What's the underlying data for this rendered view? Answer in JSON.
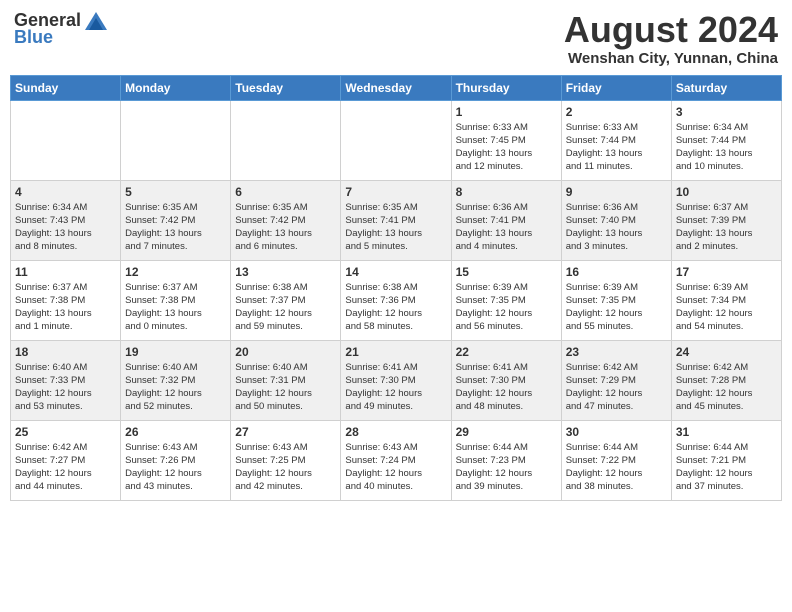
{
  "header": {
    "logo_general": "General",
    "logo_blue": "Blue",
    "month_title": "August 2024",
    "subtitle": "Wenshan City, Yunnan, China"
  },
  "days_of_week": [
    "Sunday",
    "Monday",
    "Tuesday",
    "Wednesday",
    "Thursday",
    "Friday",
    "Saturday"
  ],
  "weeks": [
    [
      {
        "day": "",
        "info": ""
      },
      {
        "day": "",
        "info": ""
      },
      {
        "day": "",
        "info": ""
      },
      {
        "day": "",
        "info": ""
      },
      {
        "day": "1",
        "info": "Sunrise: 6:33 AM\nSunset: 7:45 PM\nDaylight: 13 hours\nand 12 minutes."
      },
      {
        "day": "2",
        "info": "Sunrise: 6:33 AM\nSunset: 7:44 PM\nDaylight: 13 hours\nand 11 minutes."
      },
      {
        "day": "3",
        "info": "Sunrise: 6:34 AM\nSunset: 7:44 PM\nDaylight: 13 hours\nand 10 minutes."
      }
    ],
    [
      {
        "day": "4",
        "info": "Sunrise: 6:34 AM\nSunset: 7:43 PM\nDaylight: 13 hours\nand 8 minutes."
      },
      {
        "day": "5",
        "info": "Sunrise: 6:35 AM\nSunset: 7:42 PM\nDaylight: 13 hours\nand 7 minutes."
      },
      {
        "day": "6",
        "info": "Sunrise: 6:35 AM\nSunset: 7:42 PM\nDaylight: 13 hours\nand 6 minutes."
      },
      {
        "day": "7",
        "info": "Sunrise: 6:35 AM\nSunset: 7:41 PM\nDaylight: 13 hours\nand 5 minutes."
      },
      {
        "day": "8",
        "info": "Sunrise: 6:36 AM\nSunset: 7:41 PM\nDaylight: 13 hours\nand 4 minutes."
      },
      {
        "day": "9",
        "info": "Sunrise: 6:36 AM\nSunset: 7:40 PM\nDaylight: 13 hours\nand 3 minutes."
      },
      {
        "day": "10",
        "info": "Sunrise: 6:37 AM\nSunset: 7:39 PM\nDaylight: 13 hours\nand 2 minutes."
      }
    ],
    [
      {
        "day": "11",
        "info": "Sunrise: 6:37 AM\nSunset: 7:38 PM\nDaylight: 13 hours\nand 1 minute."
      },
      {
        "day": "12",
        "info": "Sunrise: 6:37 AM\nSunset: 7:38 PM\nDaylight: 13 hours\nand 0 minutes."
      },
      {
        "day": "13",
        "info": "Sunrise: 6:38 AM\nSunset: 7:37 PM\nDaylight: 12 hours\nand 59 minutes."
      },
      {
        "day": "14",
        "info": "Sunrise: 6:38 AM\nSunset: 7:36 PM\nDaylight: 12 hours\nand 58 minutes."
      },
      {
        "day": "15",
        "info": "Sunrise: 6:39 AM\nSunset: 7:35 PM\nDaylight: 12 hours\nand 56 minutes."
      },
      {
        "day": "16",
        "info": "Sunrise: 6:39 AM\nSunset: 7:35 PM\nDaylight: 12 hours\nand 55 minutes."
      },
      {
        "day": "17",
        "info": "Sunrise: 6:39 AM\nSunset: 7:34 PM\nDaylight: 12 hours\nand 54 minutes."
      }
    ],
    [
      {
        "day": "18",
        "info": "Sunrise: 6:40 AM\nSunset: 7:33 PM\nDaylight: 12 hours\nand 53 minutes."
      },
      {
        "day": "19",
        "info": "Sunrise: 6:40 AM\nSunset: 7:32 PM\nDaylight: 12 hours\nand 52 minutes."
      },
      {
        "day": "20",
        "info": "Sunrise: 6:40 AM\nSunset: 7:31 PM\nDaylight: 12 hours\nand 50 minutes."
      },
      {
        "day": "21",
        "info": "Sunrise: 6:41 AM\nSunset: 7:30 PM\nDaylight: 12 hours\nand 49 minutes."
      },
      {
        "day": "22",
        "info": "Sunrise: 6:41 AM\nSunset: 7:30 PM\nDaylight: 12 hours\nand 48 minutes."
      },
      {
        "day": "23",
        "info": "Sunrise: 6:42 AM\nSunset: 7:29 PM\nDaylight: 12 hours\nand 47 minutes."
      },
      {
        "day": "24",
        "info": "Sunrise: 6:42 AM\nSunset: 7:28 PM\nDaylight: 12 hours\nand 45 minutes."
      }
    ],
    [
      {
        "day": "25",
        "info": "Sunrise: 6:42 AM\nSunset: 7:27 PM\nDaylight: 12 hours\nand 44 minutes."
      },
      {
        "day": "26",
        "info": "Sunrise: 6:43 AM\nSunset: 7:26 PM\nDaylight: 12 hours\nand 43 minutes."
      },
      {
        "day": "27",
        "info": "Sunrise: 6:43 AM\nSunset: 7:25 PM\nDaylight: 12 hours\nand 42 minutes."
      },
      {
        "day": "28",
        "info": "Sunrise: 6:43 AM\nSunset: 7:24 PM\nDaylight: 12 hours\nand 40 minutes."
      },
      {
        "day": "29",
        "info": "Sunrise: 6:44 AM\nSunset: 7:23 PM\nDaylight: 12 hours\nand 39 minutes."
      },
      {
        "day": "30",
        "info": "Sunrise: 6:44 AM\nSunset: 7:22 PM\nDaylight: 12 hours\nand 38 minutes."
      },
      {
        "day": "31",
        "info": "Sunrise: 6:44 AM\nSunset: 7:21 PM\nDaylight: 12 hours\nand 37 minutes."
      }
    ]
  ]
}
